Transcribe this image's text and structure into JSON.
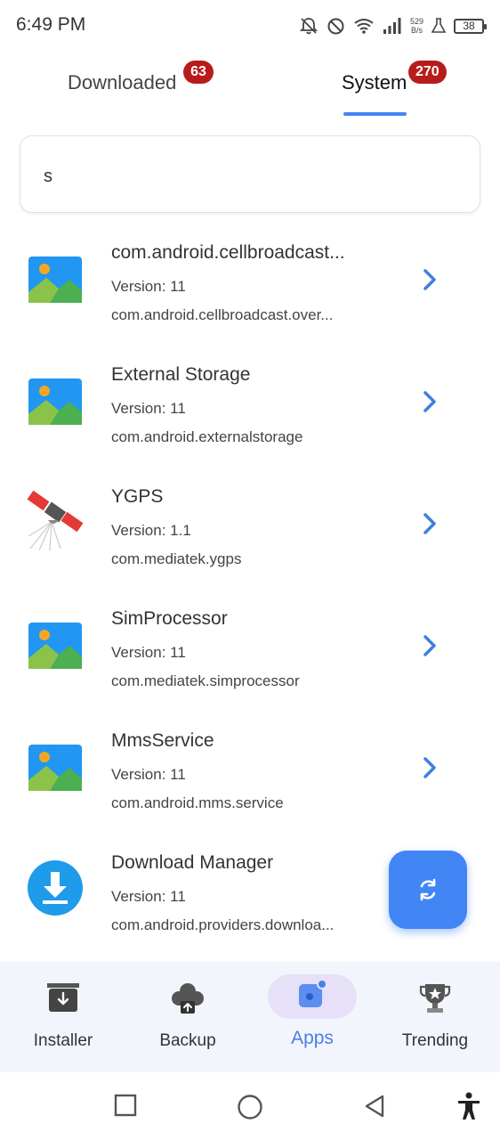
{
  "status_bar": {
    "time": "6:49 PM",
    "net_speed_value": "529",
    "net_speed_unit": "B/s",
    "battery": "38",
    "icons": [
      "mute-icon",
      "dnd-icon",
      "wifi-icon",
      "signal-icon",
      "lab-icon",
      "battery-icon"
    ]
  },
  "tabs": [
    {
      "label": "Downloaded",
      "count": "63",
      "active": false
    },
    {
      "label": "System",
      "count": "270",
      "active": true
    }
  ],
  "search": {
    "value": "s"
  },
  "apps": [
    {
      "name": "com.android.cellbroadcast...",
      "version": "Version: 11",
      "package": "com.android.cellbroadcast.over...",
      "icon": "image-placeholder-icon"
    },
    {
      "name": "External Storage",
      "version": "Version: 11",
      "package": "com.android.externalstorage",
      "icon": "image-placeholder-icon"
    },
    {
      "name": "YGPS",
      "version": "Version: 1.1",
      "package": "com.mediatek.ygps",
      "icon": "satellite-icon"
    },
    {
      "name": "SimProcessor",
      "version": "Version: 11",
      "package": "com.mediatek.simprocessor",
      "icon": "image-placeholder-icon"
    },
    {
      "name": "MmsService",
      "version": "Version: 11",
      "package": "com.android.mms.service",
      "icon": "image-placeholder-icon"
    },
    {
      "name": "Download Manager",
      "version": "Version: 11",
      "package": "com.android.providers.downloa...",
      "icon": "download-icon"
    }
  ],
  "fab": {
    "icon": "refresh-icon"
  },
  "bottom_nav": [
    {
      "label": "Installer",
      "icon": "installer-icon",
      "active": false
    },
    {
      "label": "Backup",
      "icon": "cloud-upload-icon",
      "active": false
    },
    {
      "label": "Apps",
      "icon": "apps-icon",
      "active": true
    },
    {
      "label": "Trending",
      "icon": "trophy-icon",
      "active": false
    }
  ],
  "system_nav": [
    "recents-icon",
    "home-icon",
    "back-icon",
    "accessibility-icon"
  ],
  "colors": {
    "accent": "#4285f4",
    "badge": "#b71c1c",
    "nav_bg": "#f3f5fd",
    "active_pill": "#e6e1f8",
    "active_label": "#4a7ee8"
  }
}
